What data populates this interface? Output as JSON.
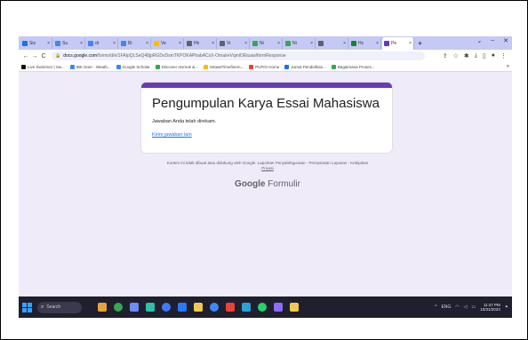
{
  "browser": {
    "tabs": [
      {
        "label": "Sis",
        "color": "#1a73e8"
      },
      {
        "label": "Su",
        "color": "#4285f4"
      },
      {
        "label": "dr",
        "color": "#4285f4"
      },
      {
        "label": "Bi",
        "color": "#4285f4"
      },
      {
        "label": "Ve",
        "color": "#fbbc04"
      },
      {
        "label": "Hk",
        "color": "#5f6368"
      },
      {
        "label": "Vi",
        "color": "#5f6368"
      },
      {
        "label": "Ni",
        "color": "#34a853"
      },
      {
        "label": "Ni",
        "color": "#34a853"
      },
      {
        "label": "",
        "color": "#5f6368"
      },
      {
        "label": "Hc",
        "color": "#188038"
      },
      {
        "label": "Pe",
        "color": "#673ab7",
        "active": true
      }
    ],
    "new_tab": "+",
    "back": "←",
    "forward": "→",
    "reload": "C",
    "url_host": "docs.google.com",
    "url_path": "/forms/d/e/1FAIpQLSeQ48jpRGDvDsmTKPOKAPhabACsX-OmaireVqmiOEtuaw/formResponse",
    "bookmarks": [
      {
        "label": "Live Swimmer | Sw...",
        "color": "#111111"
      },
      {
        "label": "IBK Doer - Weath...",
        "color": "#4285f4"
      },
      {
        "label": "Google Scholar",
        "color": "#4285f4"
      },
      {
        "label": "Discover Insmok &...",
        "color": "#34a853"
      },
      {
        "label": "SetawtTimefinem...",
        "color": "#fbbc04"
      },
      {
        "label": "PUFIO Home",
        "color": "#ea4335"
      },
      {
        "label": "Jurnal Pendidikan...",
        "color": "#1a73e8"
      },
      {
        "label": "Bagaimana Proses...",
        "color": "#34a853"
      }
    ],
    "bookmarks_more": "»"
  },
  "form": {
    "title": "Pengumpulan Karya Essai Mahasiswa",
    "confirmation": "Jawaban Anda telah direkam.",
    "submit_again": "Kirim jawaban lain",
    "disclaimer": "Konten ini tidak dibuat atau didukung oleh Google. Laporkan Penyalahgunaan - Persyaratan Layanan - Kebijakan",
    "disclaimer_policy": "Privasi",
    "brand_google": "Google",
    "brand_forms": "Formulir",
    "accent": "#673ab7"
  },
  "taskbar": {
    "search_label": "Search",
    "apps": [
      {
        "name": "widgets-icon",
        "color": "#e8a33d"
      },
      {
        "name": "chrome-icon",
        "color": "#34a853"
      },
      {
        "name": "files-icon",
        "color": "#6b8cff"
      },
      {
        "name": "edge-icon",
        "color": "#2bc0a8"
      },
      {
        "name": "camera-icon",
        "color": "#3c7bff"
      },
      {
        "name": "settings-icon",
        "color": "#2979ff"
      },
      {
        "name": "explorer-icon",
        "color": "#f2c94c"
      },
      {
        "name": "store-icon",
        "color": "#3a8bff"
      },
      {
        "name": "chrome2-icon",
        "color": "#ea4335"
      },
      {
        "name": "telegram-icon",
        "color": "#2aa1da"
      },
      {
        "name": "whatsapp-icon",
        "color": "#25d366"
      },
      {
        "name": "app-icon",
        "color": "#8e6bff"
      },
      {
        "name": "music-icon",
        "color": "#f2c94c"
      }
    ],
    "lang": "ENG",
    "time": "11:47 PM",
    "date": "10/31/2023"
  }
}
